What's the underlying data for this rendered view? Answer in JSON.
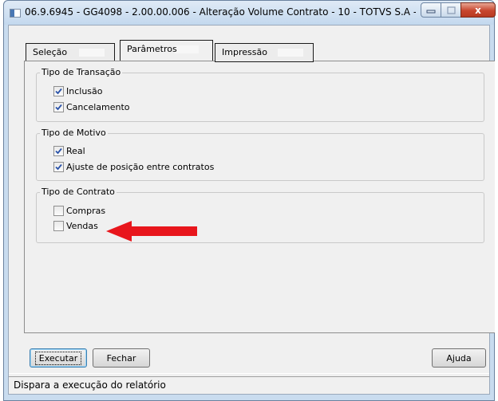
{
  "window": {
    "title": "06.9.6945 - GG4098 - 2.00.00.006 - Alteração Volume Contrato - 10 - TOTVS S.A -...",
    "close_label": "x"
  },
  "tabs": [
    {
      "label": "Seleção",
      "active": false
    },
    {
      "label": "Parâmetros",
      "active": true
    },
    {
      "label": "Impressão",
      "active": false
    }
  ],
  "groups": {
    "transacao": {
      "title": "Tipo de Transação",
      "options": [
        {
          "label": "Inclusão",
          "checked": true
        },
        {
          "label": "Cancelamento",
          "checked": true
        }
      ]
    },
    "motivo": {
      "title": "Tipo de Motivo",
      "options": [
        {
          "label": "Real",
          "checked": true
        },
        {
          "label": "Ajuste de posição entre contratos",
          "checked": true
        }
      ]
    },
    "contrato": {
      "title": "Tipo de Contrato",
      "options": [
        {
          "label": "Compras",
          "checked": false
        },
        {
          "label": "Vendas",
          "checked": false
        }
      ]
    }
  },
  "buttons": {
    "executar": "Executar",
    "fechar": "Fechar",
    "ajuda": "Ajuda"
  },
  "status": {
    "text": "Dispara a execução do relatório"
  },
  "colors": {
    "arrow": "#e8161c",
    "check": "#2a52a8"
  }
}
